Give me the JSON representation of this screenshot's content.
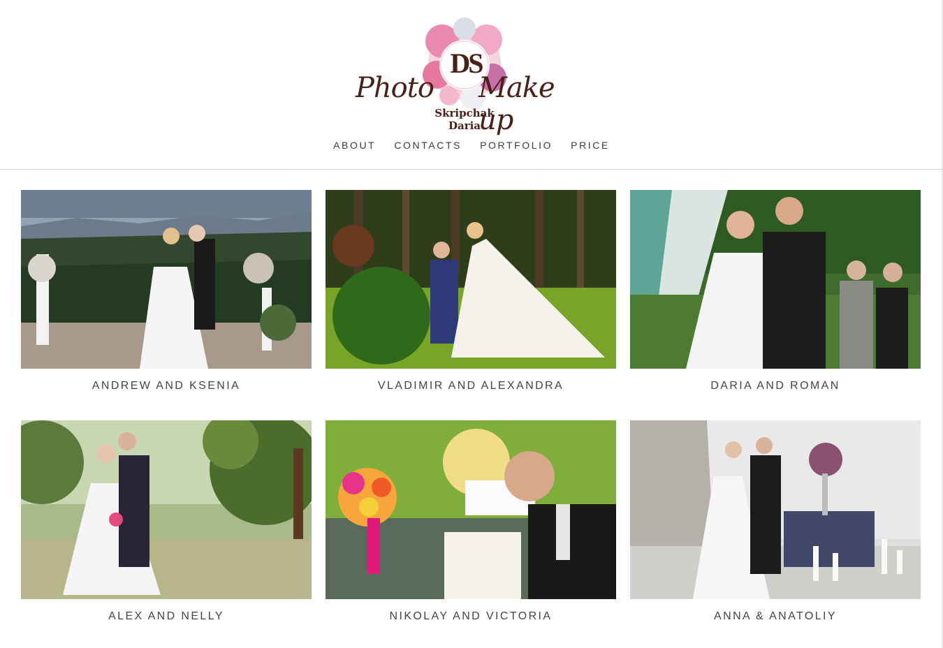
{
  "brand": {
    "monogram": "DS",
    "left_word": "Photo",
    "right_word": "Make up",
    "name_line1": "Skripchak",
    "name_line2": "Daria"
  },
  "nav": {
    "items": [
      {
        "label": "ABOUT"
      },
      {
        "label": "CONTACTS"
      },
      {
        "label": "PORTFOLIO"
      },
      {
        "label": "PRICE"
      }
    ]
  },
  "gallery": {
    "items": [
      {
        "caption": "ANDREW AND KSENIA"
      },
      {
        "caption": "VLADIMIR AND ALEXANDRA"
      },
      {
        "caption": "DARIA AND ROMAN"
      },
      {
        "caption": "ALEX AND NELLY"
      },
      {
        "caption": "NIKOLAY AND VICTORIA"
      },
      {
        "caption": "ANNA & ANATOLIY"
      }
    ]
  },
  "colors": {
    "brand_brown": "#4a2018",
    "nav_text": "#3c3c3c",
    "caption_text": "#444444",
    "divider": "#d7d7d7"
  }
}
